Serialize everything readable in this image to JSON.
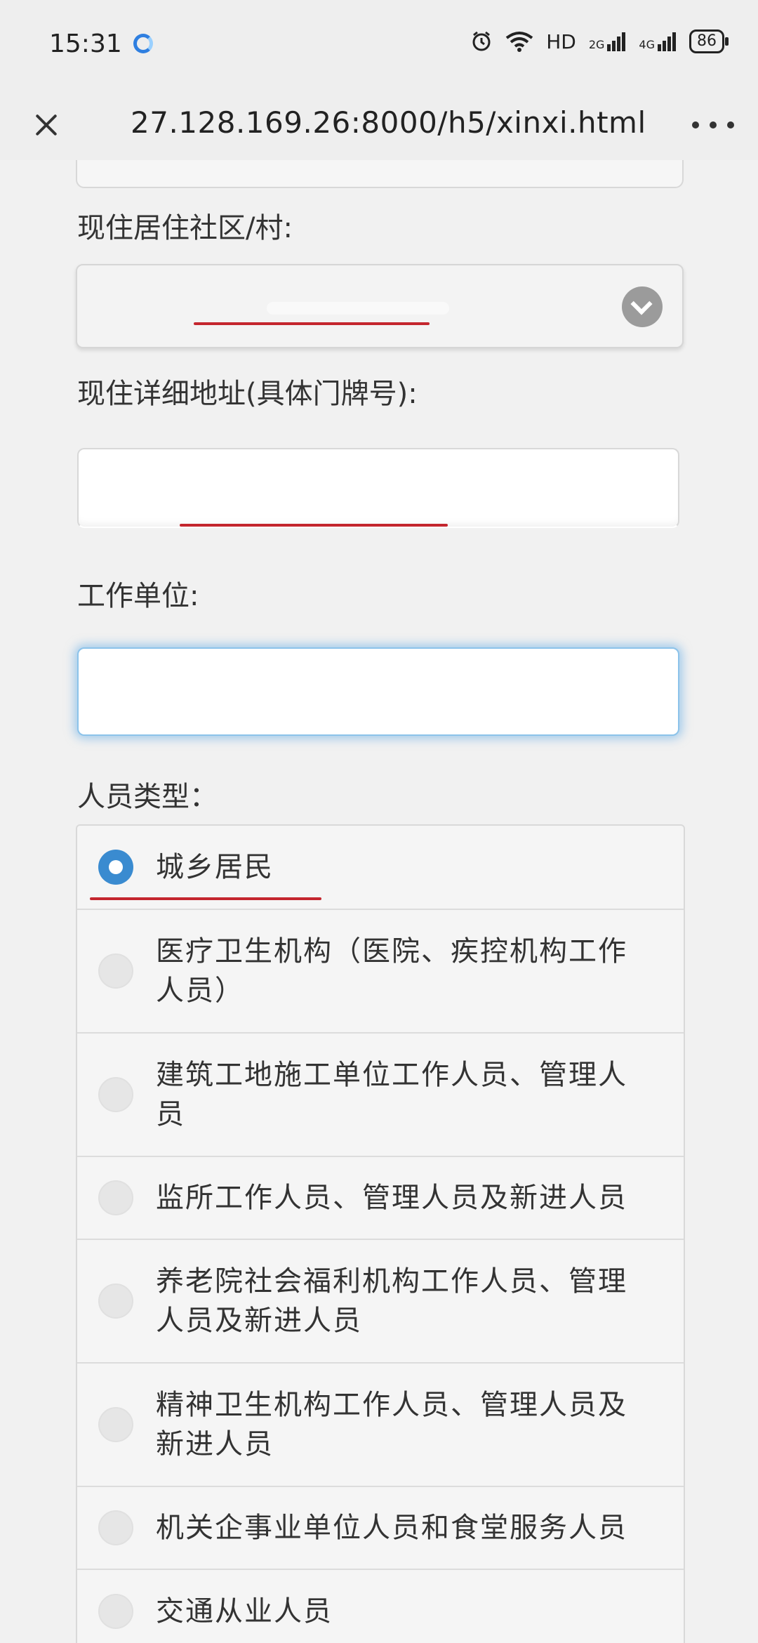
{
  "status_bar": {
    "time": "15:31",
    "network": "HD",
    "signal_1": "2G",
    "signal_2": "4G",
    "battery": "86"
  },
  "browser": {
    "url": "27.128.169.26:8000/h5/xinxi.html",
    "close_icon": "close-icon",
    "more_icon": "more-icon"
  },
  "form": {
    "community_label": "现住居住社区/村:",
    "community_value": "",
    "address_label": "现住详细地址(具体门牌号):",
    "address_value": "",
    "workplace_label": "工作单位:",
    "workplace_value": "",
    "person_type_label": "人员类型：",
    "person_types": [
      {
        "label": "城乡居民",
        "checked": true
      },
      {
        "label": "医疗卫生机构（医院、疾控机构工作人员）",
        "checked": false
      },
      {
        "label": "建筑工地施工单位工作人员、管理人员",
        "checked": false
      },
      {
        "label": "监所工作人员、管理人员及新进人员",
        "checked": false
      },
      {
        "label": "养老院社会福利机构工作人员、管理人员及新进人员",
        "checked": false
      },
      {
        "label": "精神卫生机构工作人员、管理人员及新进人员",
        "checked": false
      },
      {
        "label": "机关企事业单位人员和食堂服务人员",
        "checked": false
      },
      {
        "label": "交通从业人员",
        "checked": false
      }
    ]
  },
  "colors": {
    "accent_blue": "#3a8bd0",
    "redaction_red": "#c4262e",
    "page_bg": "#f1f1f1"
  }
}
